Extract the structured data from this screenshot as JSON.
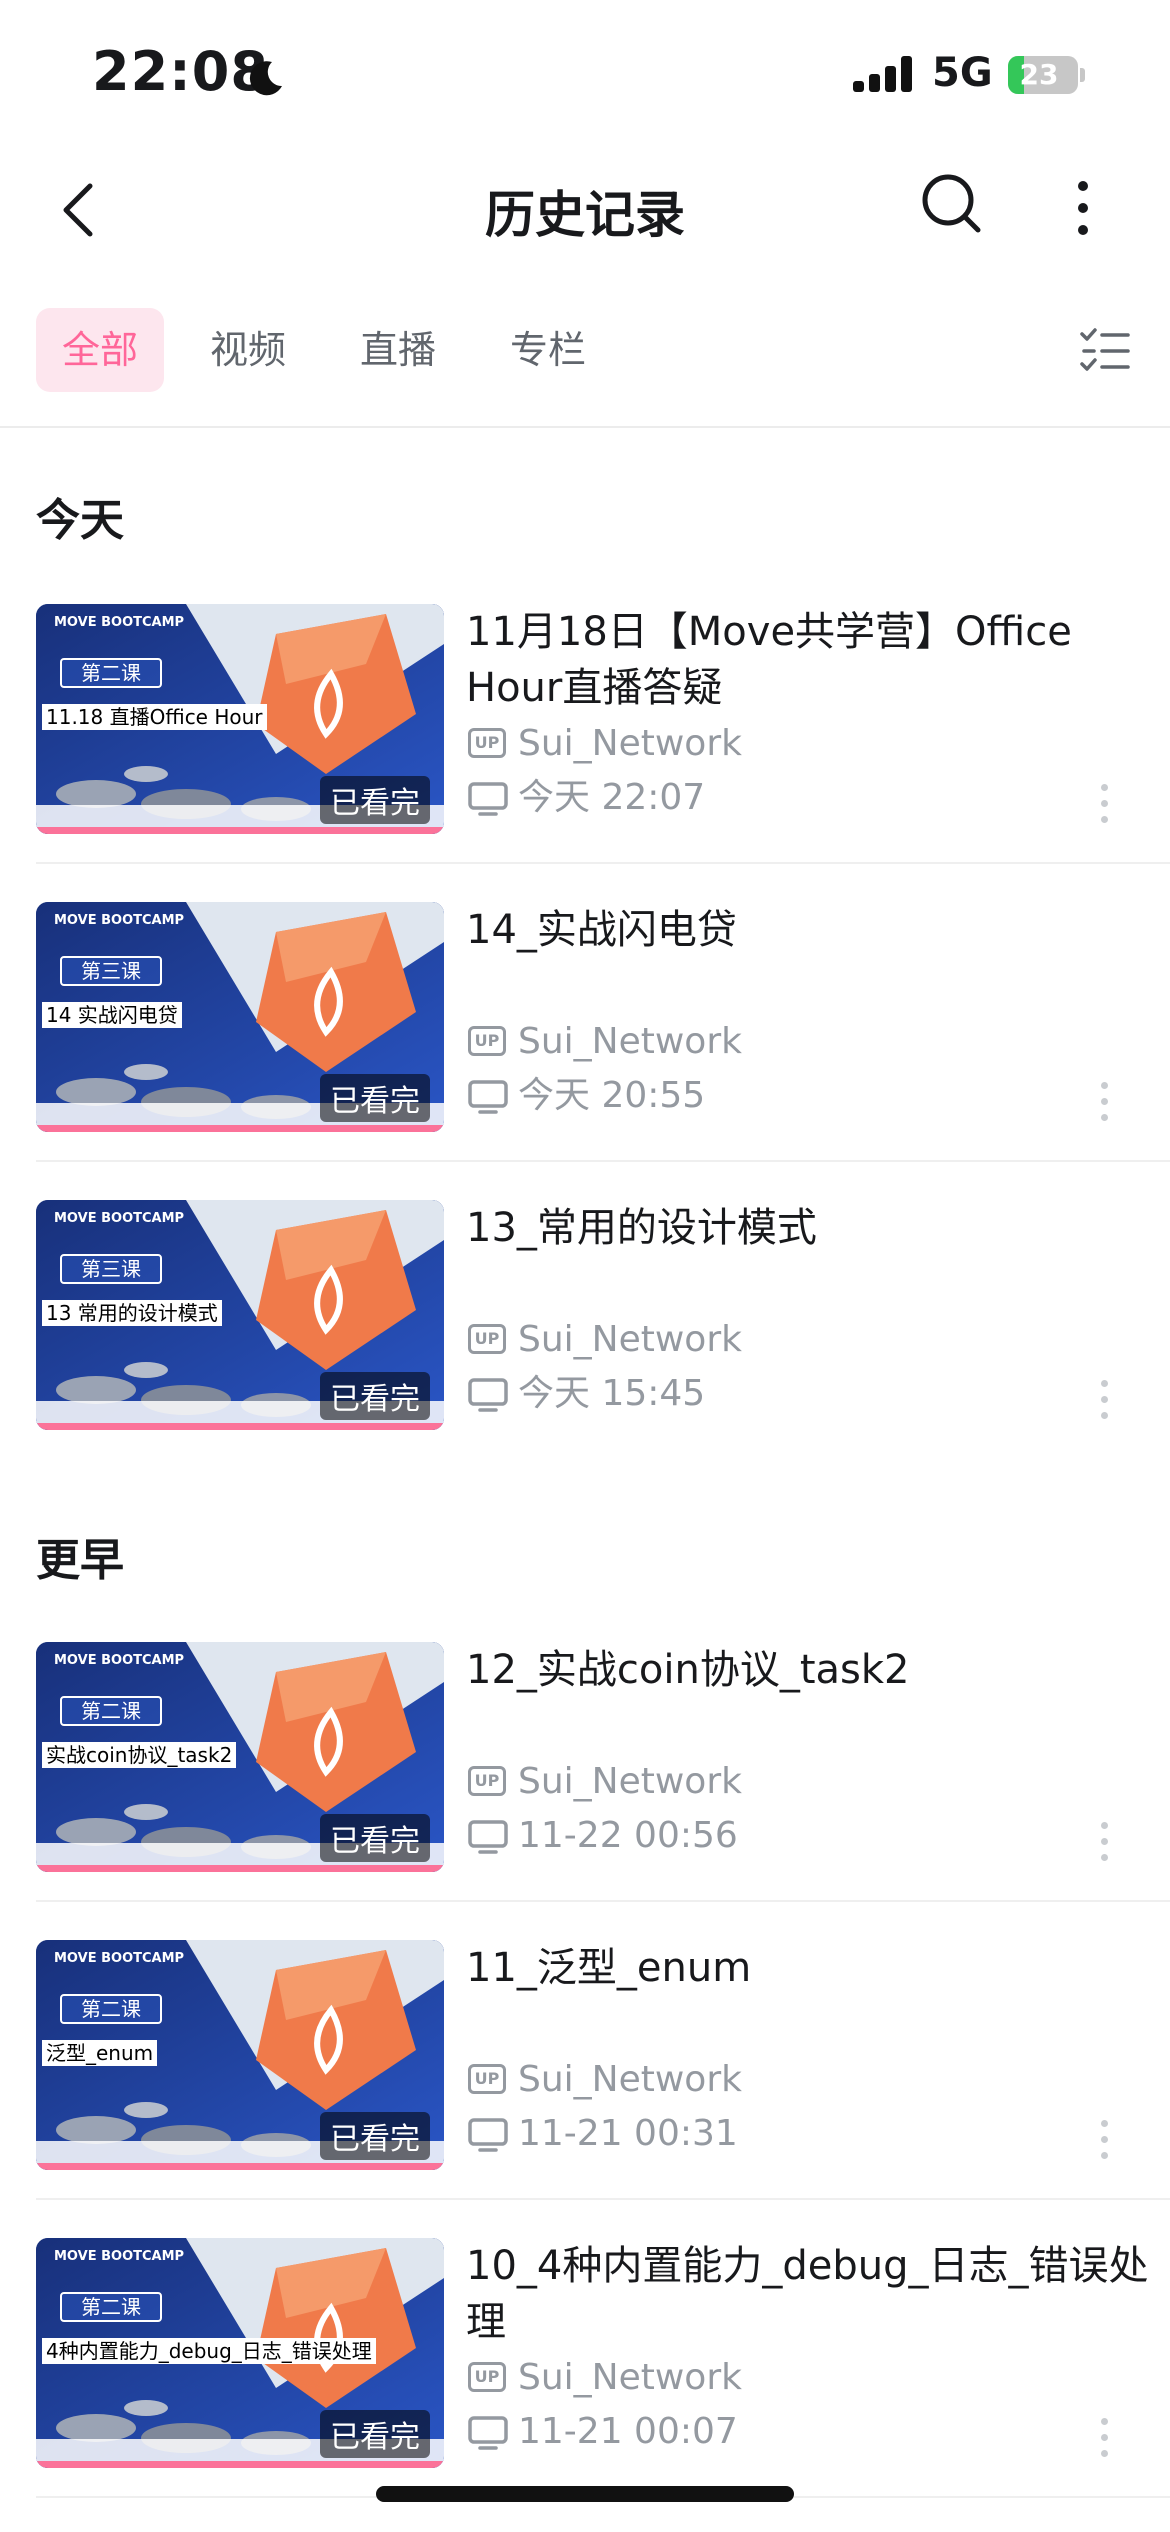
{
  "status_bar": {
    "time": "22:08",
    "network": "5G",
    "battery": "23",
    "battery_level": 0.23
  },
  "header": {
    "title": "历史记录"
  },
  "tabs": [
    {
      "label": "全部",
      "active": true
    },
    {
      "label": "视频",
      "active": false
    },
    {
      "label": "直播",
      "active": false
    },
    {
      "label": "专栏",
      "active": false
    }
  ],
  "sections": [
    {
      "label": "今天"
    },
    {
      "label": "更早"
    }
  ],
  "thumb_brand": "MOVE BOOTCAMP",
  "items": [
    {
      "title": "11月18日【Move共学营】Office Hour直播答疑",
      "uploader": "Sui_Network",
      "up_badge": "UP",
      "time": "今天 22:07",
      "lesson": "第二课",
      "caption": "11.18 直播Office Hour",
      "watched_label": "已看完",
      "progress": 1.0
    },
    {
      "title": "14_实战闪电贷",
      "uploader": "Sui_Network",
      "up_badge": "UP",
      "time": "今天 20:55",
      "lesson": "第三课",
      "caption": "14 实战闪电贷",
      "watched_label": "已看完",
      "progress": 1.0
    },
    {
      "title": "13_常用的设计模式",
      "uploader": "Sui_Network",
      "up_badge": "UP",
      "time": "今天 15:45",
      "lesson": "第三课",
      "caption": "13 常用的设计模式",
      "watched_label": "已看完",
      "progress": 1.0
    },
    {
      "title": "12_实战coin协议_task2",
      "uploader": "Sui_Network",
      "up_badge": "UP",
      "time": "11-22 00:56",
      "lesson": "第二课",
      "caption": "实战coin协议_task2",
      "watched_label": "已看完",
      "progress": 1.0
    },
    {
      "title": "11_泛型_enum",
      "uploader": "Sui_Network",
      "up_badge": "UP",
      "time": "11-21 00:31",
      "lesson": "第二课",
      "caption": "泛型_enum",
      "watched_label": "已看完",
      "progress": 1.0
    },
    {
      "title": "10_4种内置能力_debug_日志_错误处理",
      "uploader": "Sui_Network",
      "up_badge": "UP",
      "time": "11-21 00:07",
      "lesson": "第二课",
      "caption": "4种内置能力_debug_日志_错误处理",
      "watched_label": "已看完",
      "progress": 1.0
    }
  ],
  "colors": {
    "accent": "#ff6699",
    "tab_active_bg": "#fde6ee",
    "progress": "#fb7299",
    "muted": "#9499a0"
  },
  "icons": [
    "moon-icon",
    "signal-icon",
    "battery-icon",
    "back-arrow-icon",
    "search-icon",
    "more-vertical-icon",
    "edit-list-icon",
    "up-badge-icon",
    "tv-icon",
    "kebab-icon"
  ]
}
